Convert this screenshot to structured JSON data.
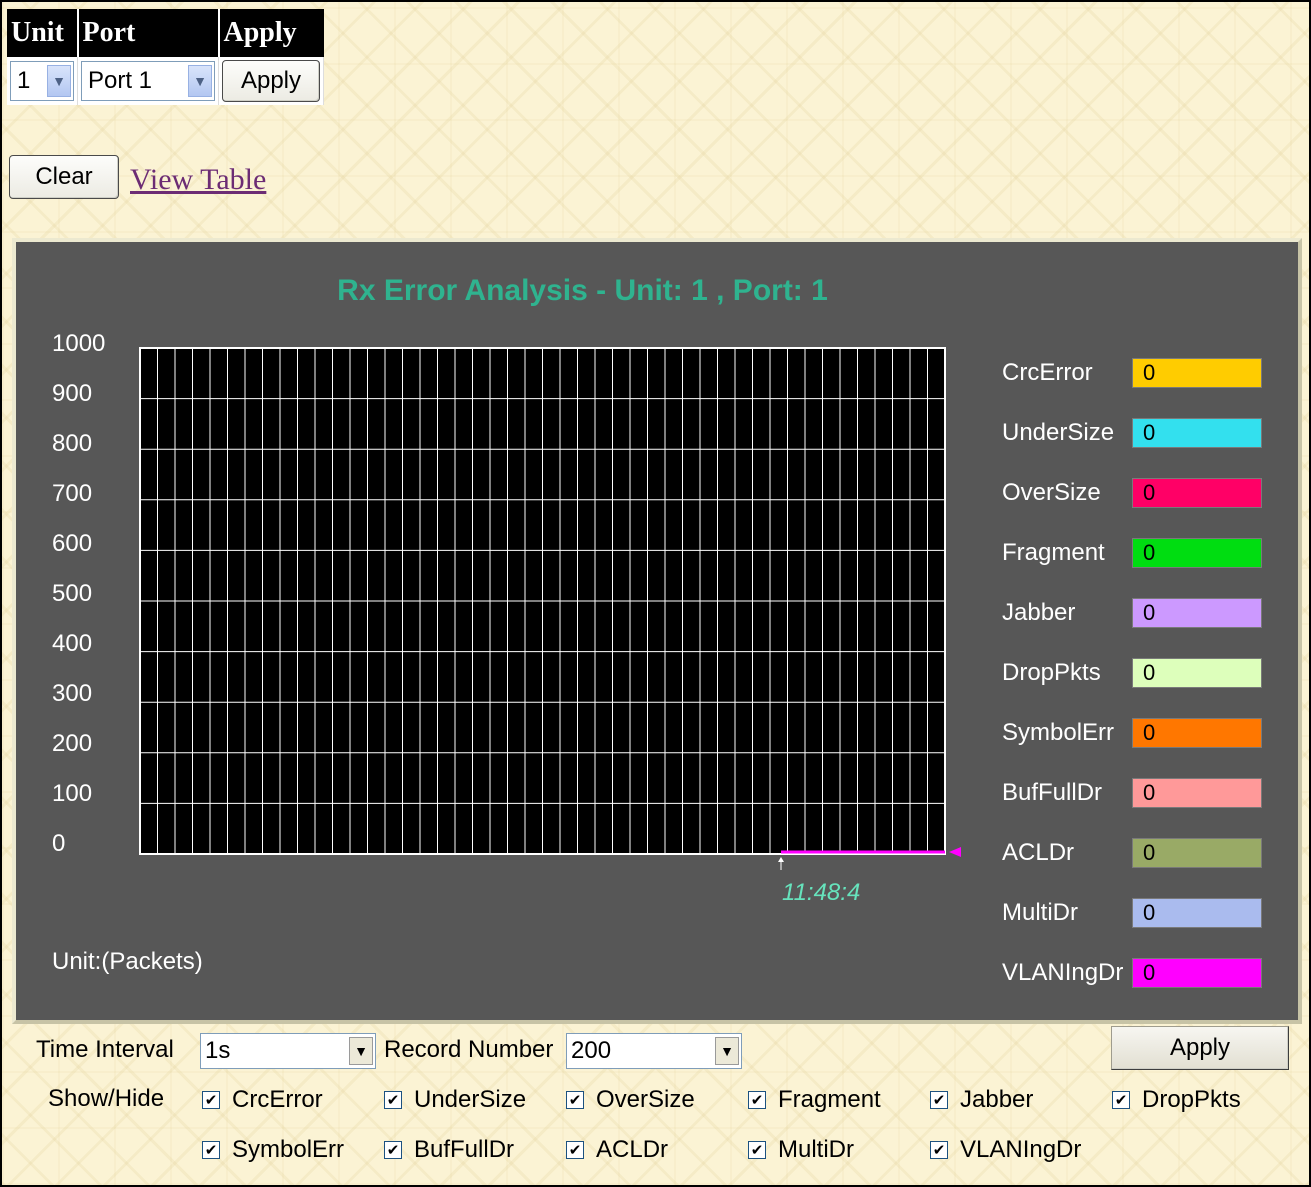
{
  "selector": {
    "headers": [
      "Unit",
      "Port",
      "Apply"
    ],
    "unit_value": "1",
    "port_value": "Port 1",
    "apply_label": "Apply"
  },
  "actions": {
    "clear_label": "Clear",
    "view_table_label": "View Table"
  },
  "chart_data": {
    "type": "line",
    "title": "Rx Error Analysis - Unit: 1 , Port: 1",
    "y_ticks": [
      "1000",
      "900",
      "800",
      "700",
      "600",
      "500",
      "400",
      "300",
      "200",
      "100",
      "0"
    ],
    "ylim": [
      0,
      1000
    ],
    "unit_label": "Unit:(Packets)",
    "time_label": "11:48:4",
    "grid": true,
    "x_divisions": 46,
    "y_divisions": 10,
    "series": [
      {
        "name": "CrcError",
        "value": 0,
        "color": "#ffcc00"
      },
      {
        "name": "UnderSize",
        "value": 0,
        "color": "#33e0ee"
      },
      {
        "name": "OverSize",
        "value": 0,
        "color": "#ff0066"
      },
      {
        "name": "Fragment",
        "value": 0,
        "color": "#00dd11"
      },
      {
        "name": "Jabber",
        "value": 0,
        "color": "#cc99ff"
      },
      {
        "name": "DropPkts",
        "value": 0,
        "color": "#ddffbb"
      },
      {
        "name": "SymbolErr",
        "value": 0,
        "color": "#ff7700"
      },
      {
        "name": "BufFullDr",
        "value": 0,
        "color": "#ff9999"
      },
      {
        "name": "ACLDr",
        "value": 0,
        "color": "#99aa66"
      },
      {
        "name": "MultiDr",
        "value": 0,
        "color": "#aabbee"
      },
      {
        "name": "VLANIngDr",
        "value": 0,
        "color": "#ff00ff"
      }
    ],
    "plotted_line_color": "#ff00ff"
  },
  "controls": {
    "time_interval_label": "Time Interval",
    "time_interval_value": "1s",
    "record_number_label": "Record Number",
    "record_number_value": "200",
    "apply_label": "Apply",
    "show_hide_label": "Show/Hide",
    "checkboxes": [
      {
        "label": "CrcError",
        "checked": true
      },
      {
        "label": "UnderSize",
        "checked": true
      },
      {
        "label": "OverSize",
        "checked": true
      },
      {
        "label": "Fragment",
        "checked": true
      },
      {
        "label": "Jabber",
        "checked": true
      },
      {
        "label": "DropPkts",
        "checked": true
      },
      {
        "label": "SymbolErr",
        "checked": true
      },
      {
        "label": "BufFullDr",
        "checked": true
      },
      {
        "label": "ACLDr",
        "checked": true
      },
      {
        "label": "MultiDr",
        "checked": true
      },
      {
        "label": "VLANIngDr",
        "checked": true
      }
    ]
  }
}
